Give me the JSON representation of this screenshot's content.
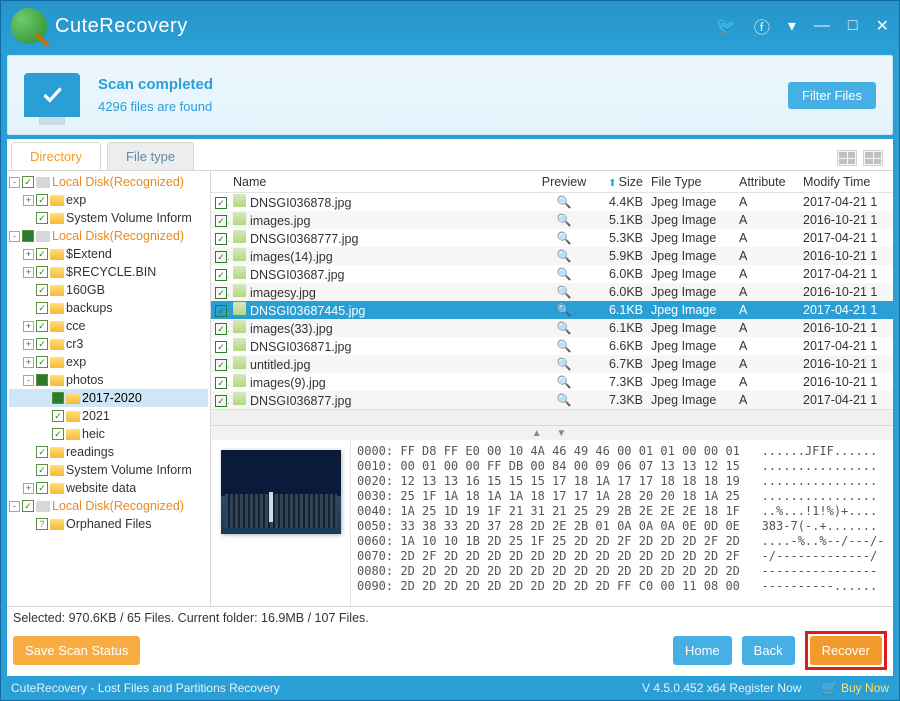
{
  "app_name": "CuteRecovery",
  "titlebar_icons": [
    "twitter",
    "facebook",
    "menu",
    "minimize",
    "maximize",
    "close"
  ],
  "status": {
    "title": "Scan completed",
    "sub": "4296 files are found"
  },
  "filter_button": "Filter Files",
  "tabs": {
    "directory": "Directory",
    "filetype": "File type",
    "active": 0
  },
  "tree": [
    {
      "lvl": 0,
      "exp": "-",
      "chk": "on",
      "ic": "disk",
      "label": "Local Disk(Recognized)",
      "accent": true
    },
    {
      "lvl": 1,
      "exp": "+",
      "chk": "on",
      "ic": "folder",
      "label": "exp"
    },
    {
      "lvl": 1,
      "exp": " ",
      "chk": "on",
      "ic": "folder",
      "label": "System Volume Inform"
    },
    {
      "lvl": 0,
      "exp": "-",
      "chk": "partial",
      "ic": "disk",
      "label": "Local Disk(Recognized)",
      "accent": true
    },
    {
      "lvl": 1,
      "exp": "+",
      "chk": "on",
      "ic": "folder",
      "label": "$Extend"
    },
    {
      "lvl": 1,
      "exp": "+",
      "chk": "on",
      "ic": "folder",
      "label": "$RECYCLE.BIN"
    },
    {
      "lvl": 1,
      "exp": " ",
      "chk": "on",
      "ic": "folder",
      "label": "160GB"
    },
    {
      "lvl": 1,
      "exp": " ",
      "chk": "on",
      "ic": "folder",
      "label": "backups"
    },
    {
      "lvl": 1,
      "exp": "+",
      "chk": "on",
      "ic": "folder",
      "label": "cce"
    },
    {
      "lvl": 1,
      "exp": "+",
      "chk": "on",
      "ic": "folder",
      "label": "cr3"
    },
    {
      "lvl": 1,
      "exp": "+",
      "chk": "on",
      "ic": "folder",
      "label": "exp"
    },
    {
      "lvl": 1,
      "exp": "-",
      "chk": "partial",
      "ic": "folder",
      "label": "photos"
    },
    {
      "lvl": 2,
      "exp": " ",
      "chk": "partial",
      "ic": "folder",
      "label": "2017-2020",
      "sel": true
    },
    {
      "lvl": 2,
      "exp": " ",
      "chk": "on",
      "ic": "folder",
      "label": "2021"
    },
    {
      "lvl": 2,
      "exp": " ",
      "chk": "on",
      "ic": "folder",
      "label": "heic"
    },
    {
      "lvl": 1,
      "exp": " ",
      "chk": "on",
      "ic": "folder",
      "label": "readings"
    },
    {
      "lvl": 1,
      "exp": " ",
      "chk": "on",
      "ic": "folder",
      "label": "System Volume Inform"
    },
    {
      "lvl": 1,
      "exp": "+",
      "chk": "on",
      "ic": "folder",
      "label": "website data"
    },
    {
      "lvl": 0,
      "exp": "-",
      "chk": "on",
      "ic": "disk",
      "label": "Local Disk(Recognized)",
      "accent": true
    },
    {
      "lvl": 1,
      "exp": " ",
      "chk": "q",
      "ic": "folder",
      "label": "Orphaned Files"
    }
  ],
  "columns": {
    "name": "Name",
    "preview": "Preview",
    "size": "Size",
    "type": "File Type",
    "attr": "Attribute",
    "modify": "Modify Time"
  },
  "files": [
    {
      "name": "DNSGI036878.jpg",
      "size": "4.4KB",
      "type": "Jpeg Image",
      "attr": "A",
      "mod": "2017-04-21 1"
    },
    {
      "name": "images.jpg",
      "size": "5.1KB",
      "type": "Jpeg Image",
      "attr": "A",
      "mod": "2016-10-21 1"
    },
    {
      "name": "DNSGI0368777.jpg",
      "size": "5.3KB",
      "type": "Jpeg Image",
      "attr": "A",
      "mod": "2017-04-21 1"
    },
    {
      "name": "images(14).jpg",
      "size": "5.9KB",
      "type": "Jpeg Image",
      "attr": "A",
      "mod": "2016-10-21 1"
    },
    {
      "name": "DNSGI03687.jpg",
      "size": "6.0KB",
      "type": "Jpeg Image",
      "attr": "A",
      "mod": "2017-04-21 1"
    },
    {
      "name": "imagesy.jpg",
      "size": "6.0KB",
      "type": "Jpeg Image",
      "attr": "A",
      "mod": "2016-10-21 1"
    },
    {
      "name": "DNSGI03687445.jpg",
      "size": "6.1KB",
      "type": "Jpeg Image",
      "attr": "A",
      "mod": "2017-04-21 1",
      "sel": true
    },
    {
      "name": "images(33).jpg",
      "size": "6.1KB",
      "type": "Jpeg Image",
      "attr": "A",
      "mod": "2016-10-21 1"
    },
    {
      "name": "DNSGI036871.jpg",
      "size": "6.6KB",
      "type": "Jpeg Image",
      "attr": "A",
      "mod": "2017-04-21 1"
    },
    {
      "name": "untitled.jpg",
      "size": "6.7KB",
      "type": "Jpeg Image",
      "attr": "A",
      "mod": "2016-10-21 1"
    },
    {
      "name": "images(9).jpg",
      "size": "7.3KB",
      "type": "Jpeg Image",
      "attr": "A",
      "mod": "2016-10-21 1"
    },
    {
      "name": "DNSGI036877.jpg",
      "size": "7.3KB",
      "type": "Jpeg Image",
      "attr": "A",
      "mod": "2017-04-21 1"
    }
  ],
  "hex_lines": [
    "0000: FF D8 FF E0 00 10 4A 46 49 46 00 01 01 00 00 01   ......JFIF......",
    "0010: 00 01 00 00 FF DB 00 84 00 09 06 07 13 13 12 15   ................",
    "0020: 12 13 13 16 15 15 15 17 18 1A 17 17 18 18 18 19   ................",
    "0030: 25 1F 1A 18 1A 1A 18 17 17 1A 28 20 20 18 1A 25   ................",
    "0040: 1A 25 1D 19 1F 21 31 21 25 29 2B 2E 2E 2E 18 1F   ..%...!1!%)+....",
    "0050: 33 38 33 2D 37 28 2D 2E 2B 01 0A 0A 0A 0E 0D 0E   383-7(-.+.......",
    "0060: 1A 10 10 1B 2D 25 1F 25 2D 2D 2F 2D 2D 2D 2F 2D   ....-%..%--/---/-",
    "0070: 2D 2F 2D 2D 2D 2D 2D 2D 2D 2D 2D 2D 2D 2D 2D 2F   -/-------------/",
    "0080: 2D 2D 2D 2D 2D 2D 2D 2D 2D 2D 2D 2D 2D 2D 2D 2D   ----------------",
    "0090: 2D 2D 2D 2D 2D 2D 2D 2D 2D 2D FF C0 00 11 08 00   ----------......"
  ],
  "selection_info": "Selected: 970.6KB / 65 Files.  Current folder: 16.9MB / 107 Files.",
  "buttons": {
    "save": "Save Scan Status",
    "home": "Home",
    "back": "Back",
    "recover": "Recover"
  },
  "statusbar": {
    "left": "CuteRecovery - Lost Files and Partitions Recovery",
    "version": "V 4.5.0.452 x64  Register Now",
    "buy": "Buy Now"
  }
}
